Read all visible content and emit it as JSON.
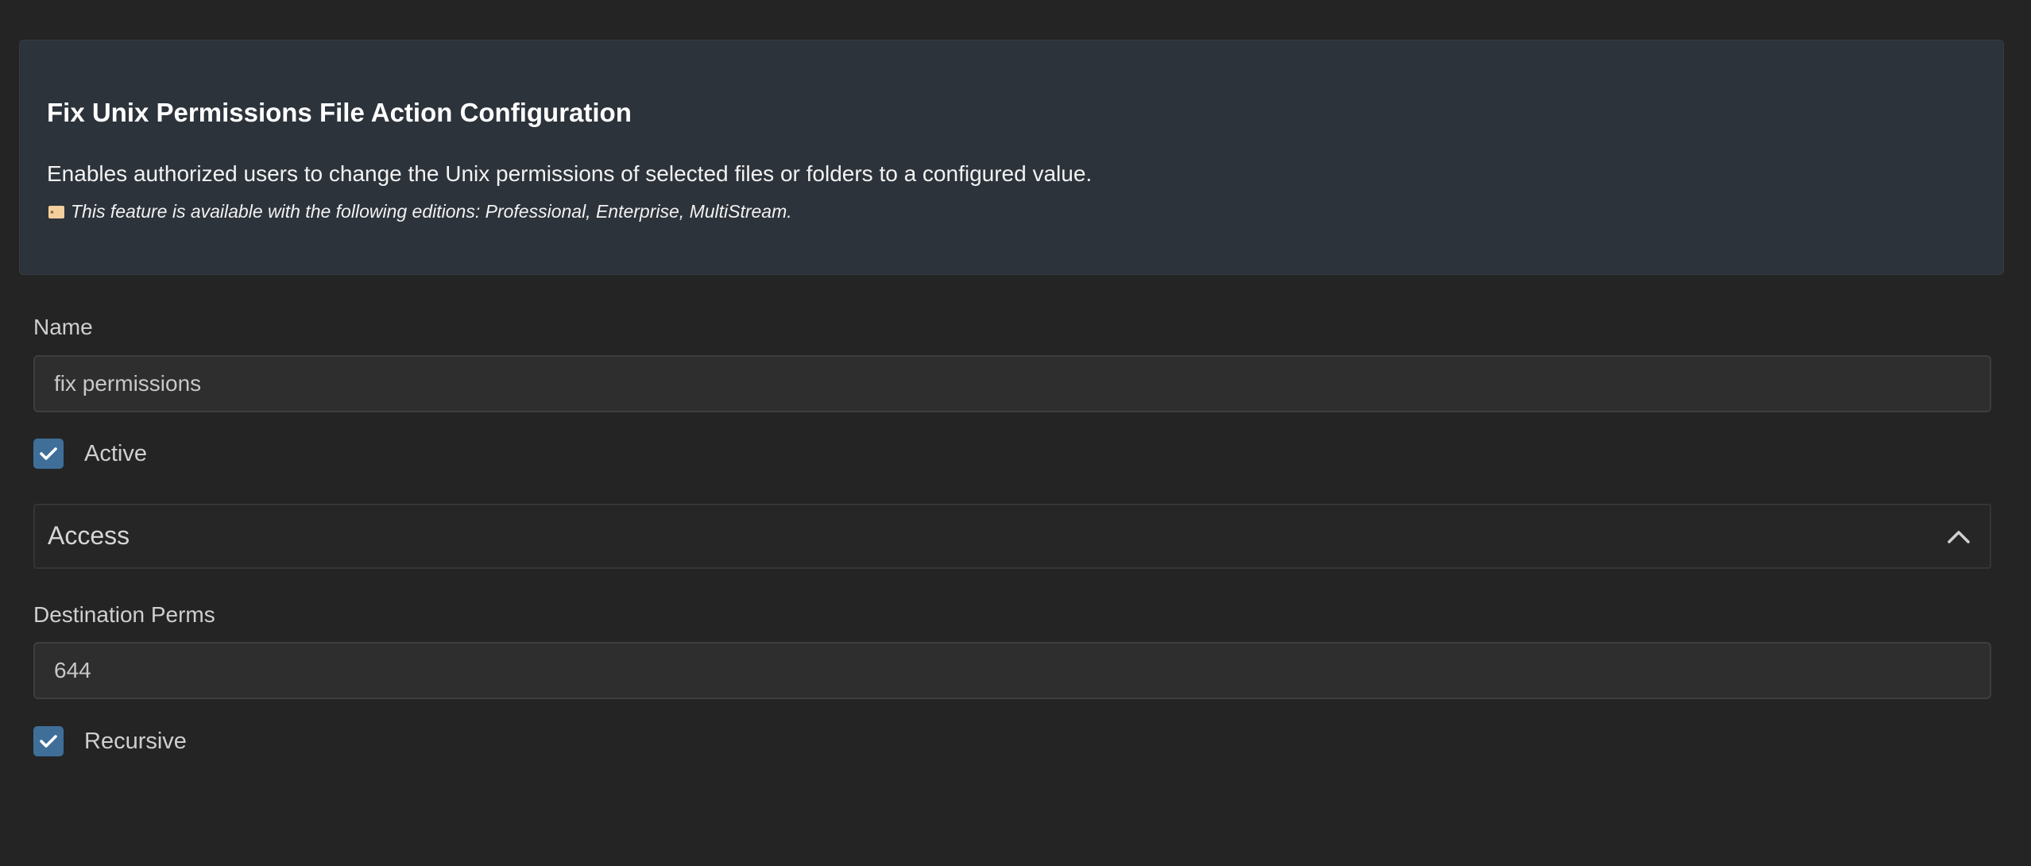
{
  "info": {
    "title": "Fix Unix Permissions File Action Configuration",
    "description": "Enables authorized users to change the Unix permissions of selected files or folders to a configured value.",
    "editions": "This feature is available with the following editions: Professional, Enterprise, MultiStream.",
    "editions_icon": "tag-icon"
  },
  "form": {
    "name": {
      "label": "Name",
      "value": "fix permissions"
    },
    "active": {
      "label": "Active",
      "checked": true
    },
    "access": {
      "title": "Access",
      "expanded": true,
      "icon": "chevron-up-icon"
    },
    "destination_perms": {
      "label": "Destination Perms",
      "value": "644"
    },
    "recursive": {
      "label": "Recursive",
      "checked": true
    }
  },
  "colors": {
    "background": "#242424",
    "panel": "#2d333b",
    "checkbox_accent": "#3f6f99",
    "input_background": "#2e2e2e"
  }
}
